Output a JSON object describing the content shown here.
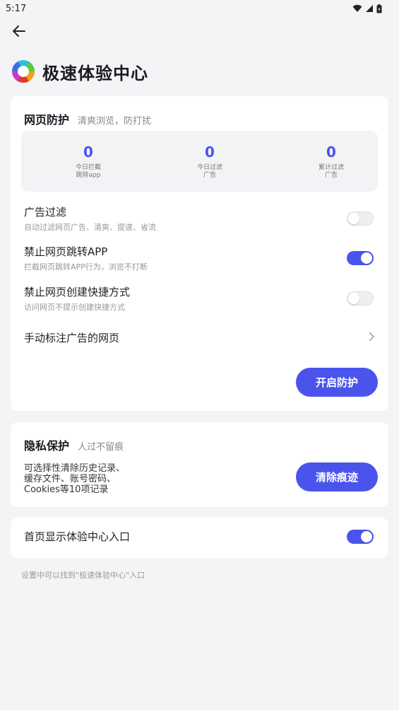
{
  "status": {
    "time": "5:17"
  },
  "header": {
    "title": "极速体验中心"
  },
  "web_protection": {
    "title": "网页防护",
    "subtitle": "清爽浏览，防打扰",
    "stats": [
      {
        "value": "0",
        "label": "今日拦截\n跳转app"
      },
      {
        "value": "0",
        "label": "今日过滤\n广告"
      },
      {
        "value": "0",
        "label": "累计过滤\n广告"
      }
    ],
    "options": [
      {
        "title": "广告过滤",
        "desc": "自动过滤网页广告、清爽、提速、省流",
        "enabled": false
      },
      {
        "title": "禁止网页跳转APP",
        "desc": "拦截网页跳转APP行为，浏览不打断",
        "enabled": true
      },
      {
        "title": "禁止网页创建快捷方式",
        "desc": "访问网页不提示创建快捷方式",
        "enabled": false
      }
    ],
    "manual_mark_label": "手动标注广告的网页",
    "button_label": "开启防护"
  },
  "privacy": {
    "title": "隐私保护",
    "subtitle": "人过不留痕",
    "description": "可选择性清除历史记录、\n缓存文件、账号密码、\nCookies等10项记录",
    "button_label": "清除痕迹"
  },
  "home_entry": {
    "label": "首页显示体验中心入口",
    "enabled": true
  },
  "footnote": "设置中可以找到\"极速体验中心\"入口",
  "colors": {
    "accent": "#4a54ec",
    "background": "#f4f4f6"
  }
}
